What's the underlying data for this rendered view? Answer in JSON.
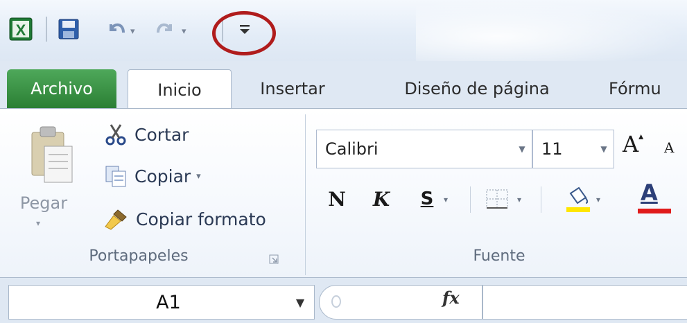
{
  "quick_access": {
    "app_icon": "excel-icon",
    "save_icon": "save-icon",
    "undo_icon": "undo-icon",
    "redo_icon": "redo-icon",
    "customize_icon": "customize-toolbar-icon",
    "highlight_color": "#b01c1c"
  },
  "tabs": [
    {
      "label": "Archivo"
    },
    {
      "label": "Inicio"
    },
    {
      "label": "Insertar"
    },
    {
      "label": "Diseño de página"
    },
    {
      "label": "Fórmu"
    }
  ],
  "clipboard": {
    "paste_label": "Pegar",
    "cut_label": "Cortar",
    "copy_label": "Copiar",
    "format_painter_label": "Copiar formato",
    "group_label": "Portapapeles"
  },
  "font": {
    "name": "Calibri",
    "size": "11",
    "bold_label": "N",
    "italic_label": "K",
    "underline_label": "S",
    "font_color_label": "A",
    "grow_label": "A",
    "shrink_label": "A",
    "group_label": "Fuente",
    "highlight_color": "#ffe600",
    "font_color": "#e01b1b"
  },
  "formula_bar": {
    "name_box": "A1",
    "fx_label": "fx",
    "value": ""
  },
  "colors": {
    "file_tab": "#2b7f34",
    "ribbon_border": "#a9b8ca"
  }
}
